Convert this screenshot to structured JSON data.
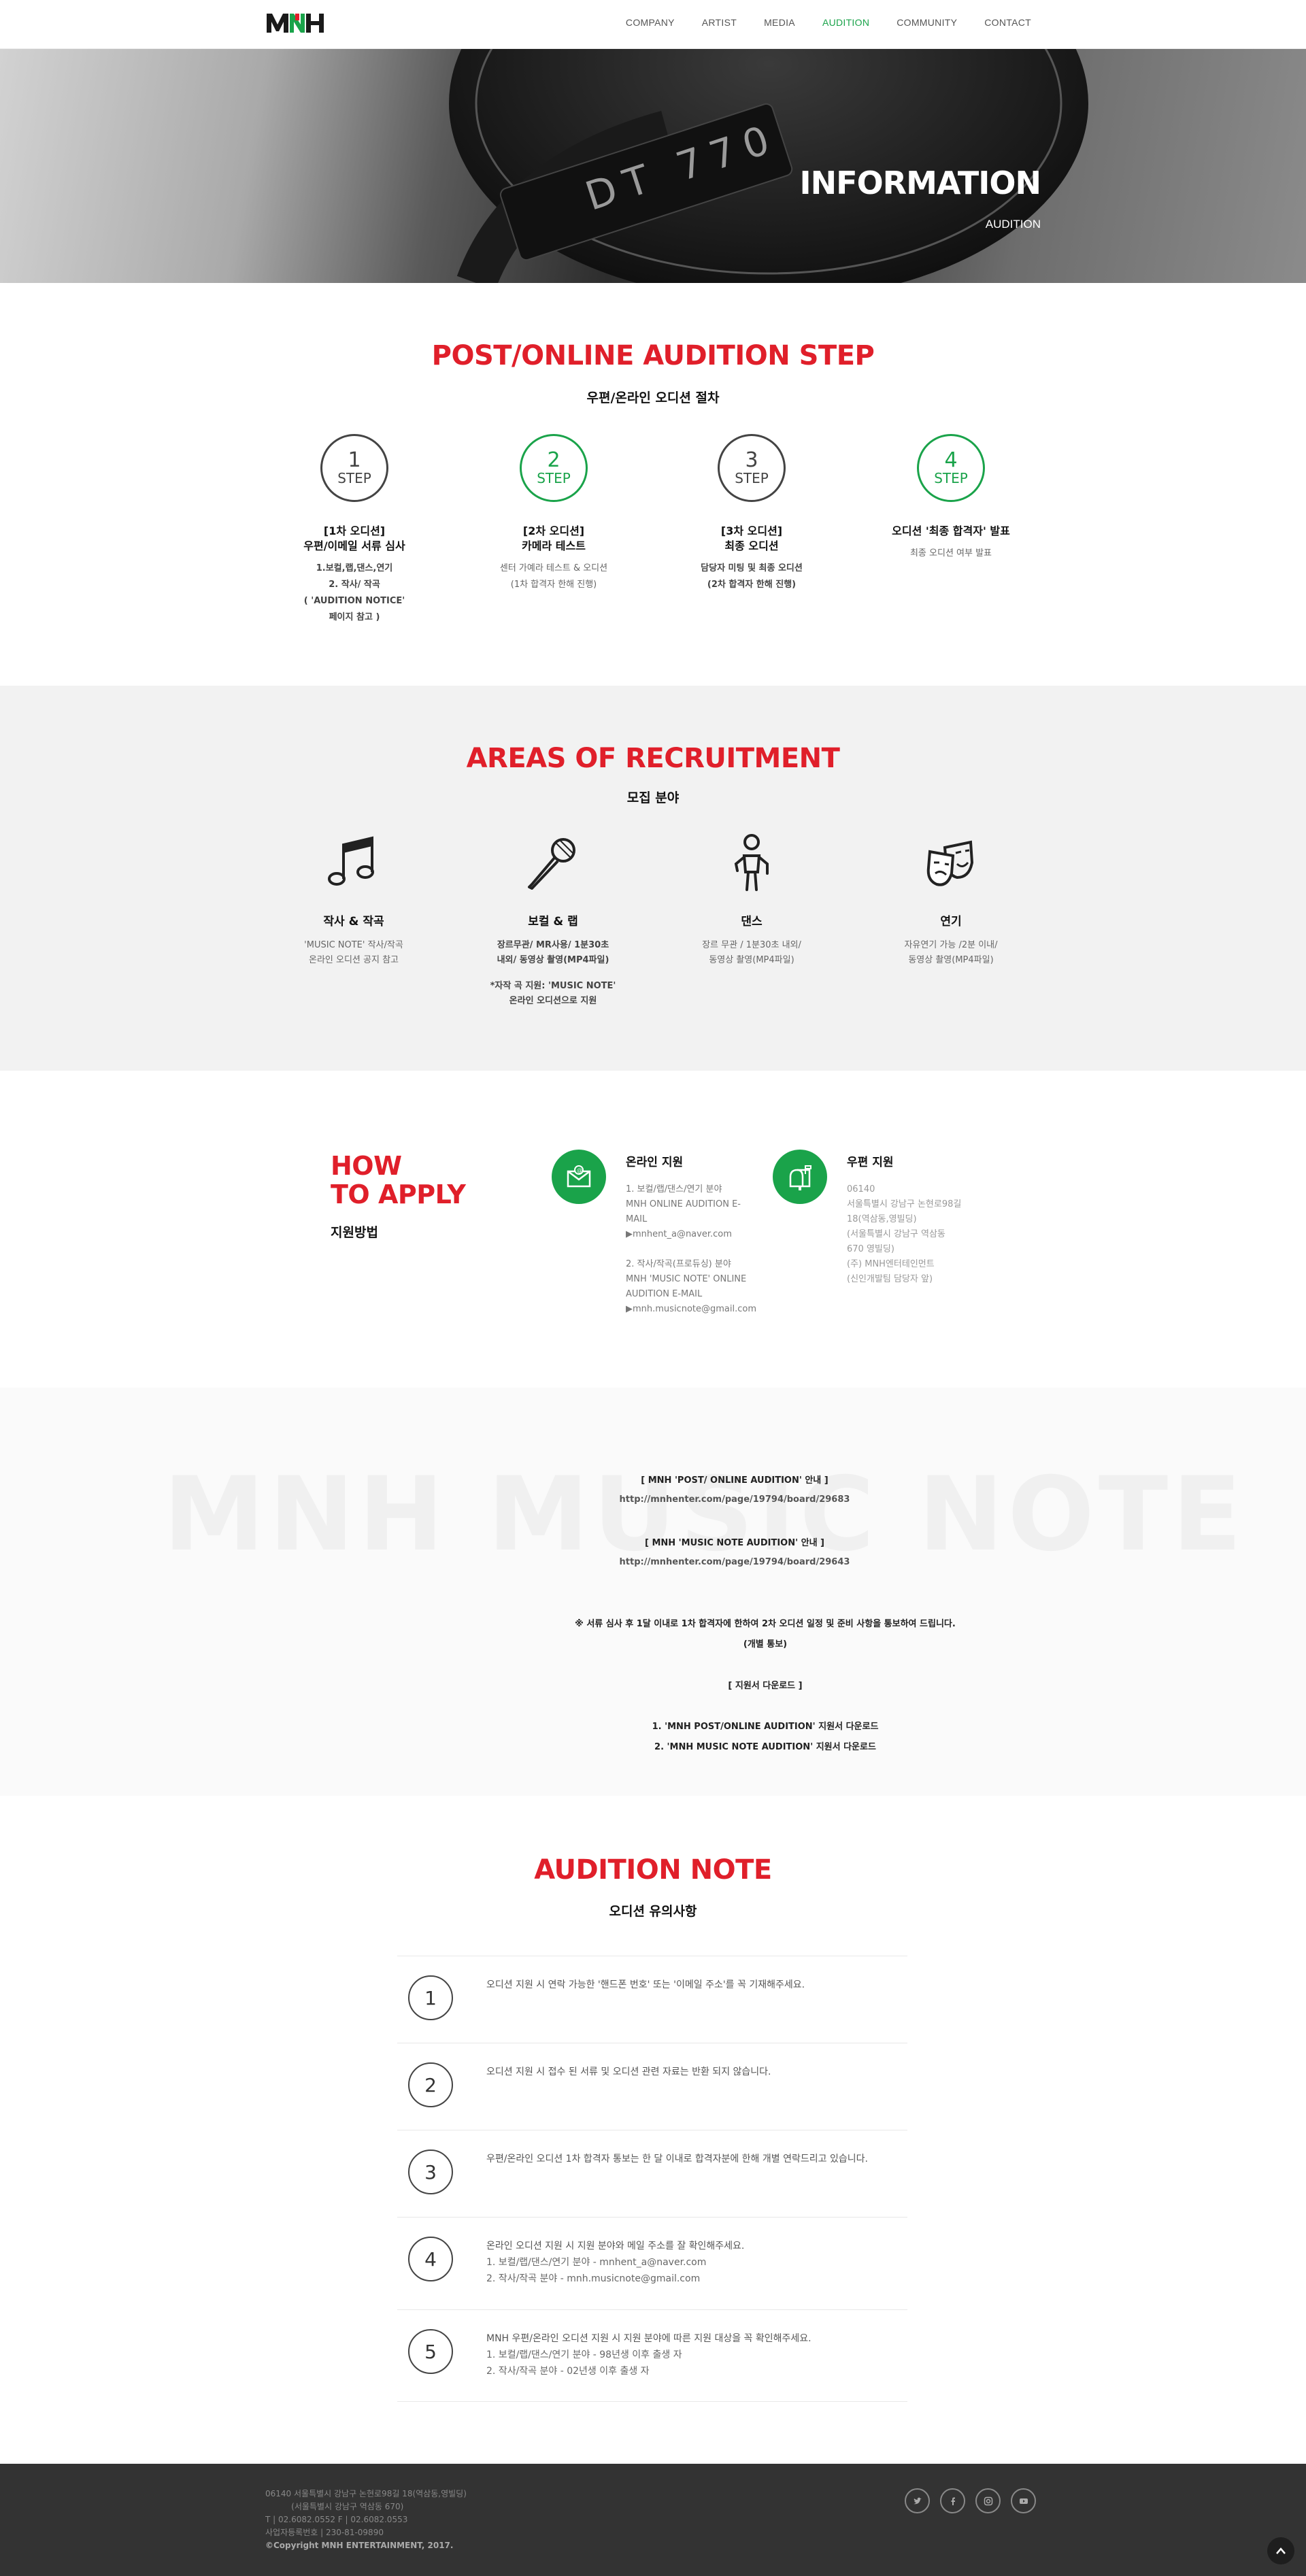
{
  "header": {
    "logo_alt": "MNH",
    "nav": [
      "COMPANY",
      "ARTIST",
      "MEDIA",
      "AUDITION",
      "COMMUNITY",
      "CONTACT"
    ],
    "active": "AUDITION"
  },
  "hero": {
    "title": "INFORMATION",
    "subtitle": "AUDITION",
    "headphone_text": "DT 770"
  },
  "steps_section": {
    "title": "POST/ONLINE AUDITION STEP",
    "subtitle": "우편/온라인 오디션 절차",
    "steps": [
      {
        "num": "1",
        "label": "STEP",
        "title1": "[1차 오디션]",
        "title2": "우편/이메일 서류 심사",
        "desc": [
          "1.보컬,랩,댄스,연기",
          "2. 작사/ 작곡",
          "( 'AUDITION NOTICE'",
          "페이지 참고 )"
        ]
      },
      {
        "num": "2",
        "label": "STEP",
        "title1": "[2차 오디션]",
        "title2": "카메라 테스트",
        "desc": [
          "센터 가예라 테스트 & 오디션",
          "(1차 합격자 한해 진행)"
        ]
      },
      {
        "num": "3",
        "label": "STEP",
        "title1": "[3차 오디션]",
        "title2": "최종 오디션",
        "desc": [
          "담당자 미팅 및 최종 오디션",
          "(2차 합격자 한해 진행)"
        ]
      },
      {
        "num": "4",
        "label": "STEP",
        "title1": "오디션 '최종 합격자' 발표",
        "title2": "",
        "desc": [
          "최종 오디션 여부 발표"
        ]
      }
    ]
  },
  "areas_section": {
    "title": "AREAS OF RECRUITMENT",
    "subtitle": "모집 분야",
    "areas": [
      {
        "icon": "music-note-icon",
        "title": "작사 & 작곡",
        "desc": [
          "'MUSIC NOTE' 작사/작곡",
          "온라인 오디션 공지 참고"
        ],
        "note": []
      },
      {
        "icon": "microphone-icon",
        "title": "보컬 & 랩",
        "desc": [
          "장르무관/ MR사용/ 1분30초",
          "내외/ 동영상 촬영(MP4파일)"
        ],
        "note": [
          "*자작 곡 지원: 'MUSIC NOTE'",
          "온라인 오디션으로 지원"
        ]
      },
      {
        "icon": "dancer-icon",
        "title": "댄스",
        "desc": [
          "장르 무관 / 1분30초 내외/",
          "동영상 촬영(MP4파일)"
        ],
        "note": []
      },
      {
        "icon": "theater-masks-icon",
        "title": "연기",
        "desc": [
          "자유연기 가능 /2분 이내/",
          "동영상 촬영(MP4파일)"
        ],
        "note": []
      }
    ]
  },
  "apply_section": {
    "title_line1": "HOW",
    "title_line2": "TO APPLY",
    "subtitle": "지원방법",
    "online": {
      "title": "온라인 지원",
      "lines_a": [
        "1. 보컬/랩/댄스/연기 분야",
        "MNH ONLINE AUDITION E-",
        "MAIL",
        "▶mnhent_a@naver.com"
      ],
      "lines_b": [
        "2. 작사/작곡(프로듀싱) 분야",
        "MNH 'MUSIC NOTE' ONLINE",
        "AUDITION E-MAIL",
        "▶mnh.musicnote@gmail.com"
      ]
    },
    "post": {
      "title": "우편 지원",
      "lines": [
        "06140",
        "서울특별시 강남구 논현로98길",
        "18(역삼동,영빌딩)",
        "(서울특별시 강남구 역삼동",
        "670 영빌딩)",
        "(주) MNH엔터테인먼트",
        "(신인개발팀 담당자 앞)"
      ]
    }
  },
  "notice_section": {
    "watermark": "MNH MUSIC NOTE",
    "post_title": "[ MNH 'POST/ ONLINE AUDITION' 안내 ]",
    "post_link": "http://mnhenter.com/page/19794/board/29683",
    "music_title": "[ MNH 'MUSIC NOTE AUDITION' 안내 ]",
    "music_link": "http://mnhenter.com/page/19794/board/29643",
    "notice_text": "※ 서류 심사 후 1달 이내로 1차 합격자에 한하여 2차 오디션 일정 및 준비 사항을 통보하여 드립니다.",
    "notice_sub": "(개별 통보)",
    "download_title": "[ 지원서 다운로드 ]",
    "download_1": "1. 'MNH POST/ONLINE AUDITION' 지원서 다운로드",
    "download_2": "2. 'MNH MUSIC  NOTE AUDITION' 지원서 다운로드"
  },
  "note_section": {
    "title": "AUDITION NOTE",
    "subtitle": "오디션 유의사항",
    "items": [
      {
        "num": "1",
        "lines": [
          "오디션 지원 시 연락 가능한 '핸드폰 번호' 또는 '이메일 주소'를 꼭 기재해주세요."
        ]
      },
      {
        "num": "2",
        "lines": [
          "오디션 지원 시 접수 된 서류 및 오디션 관련 자료는 반환 되지 않습니다."
        ]
      },
      {
        "num": "3",
        "lines": [
          "우편/온라인 오디션 1차 합격자 통보는 한 달 이내로 합격자분에 한해 개별 연락드리고 있습니다."
        ]
      },
      {
        "num": "4",
        "lines": [
          "온라인 오디션 지원 시 지원 분야와 메일 주소를 잘 확인해주세요.",
          "1. 보컬/랩/댄스/연기 분야 - mnhent_a@naver.com",
          "2. 작사/작곡 분야 - mnh.musicnote@gmail.com"
        ]
      },
      {
        "num": "5",
        "lines": [
          "MNH 우편/온라인 오디션 지원 시 지원 분야에 따른 지원 대상을 꼭 확인해주세요.",
          "1. 보컬/랩/댄스/연기 분야 - 98년생 이후 출생 자",
          "2. 작사/작곡 분야 - 02년생 이후 출생 자"
        ]
      }
    ]
  },
  "footer": {
    "line1": "06140  서울특별시 강남구 논현로98길 18(역삼동,영빌딩)",
    "line2": "          (서울특별시 강남구 역삼동 670)",
    "line3": "T | 02.6082.0552    F | 02.6082.0553",
    "line4": "사업자등록번호 | 230-81-09890",
    "copyright": "©Copyright MNH ENTERTAINMENT, 2017.",
    "socials": [
      "twitter-icon",
      "facebook-icon",
      "instagram-icon",
      "youtube-icon"
    ]
  },
  "colors": {
    "accent_red": "#e01f2a",
    "accent_green": "#1aa34a",
    "footer_bg": "#333333"
  }
}
